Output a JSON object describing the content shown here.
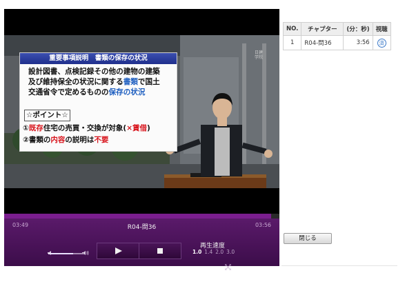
{
  "video": {
    "logo_text": "日建学院",
    "slide": {
      "heading": "重要事項説明　書類の保存の状況",
      "line1": "設計図書、点検記録その他の建物の建築",
      "line2_pre": "及び維持保全の状況に関する",
      "line2_hl": "書類",
      "line2_post": "で国土",
      "line3_pre": "交通省令で定めるものの",
      "line3_hl": "保存の状況",
      "point": "☆ポイント☆",
      "rule1_pre": "①",
      "rule1_red1": "既存",
      "rule1_mid": "住宅の売買・交換が対象(",
      "rule1_red2": "×賃借",
      "rule1_end": ")",
      "rule2_pre": "②書類の",
      "rule2_red1": "内容",
      "rule2_mid": "の説明は",
      "rule2_red2": "不要"
    }
  },
  "player": {
    "current_time": "03:49",
    "total_time": "03:56",
    "title": "R04-問36",
    "progress": 0.97,
    "volume": 0.7,
    "speed_label": "再生速度",
    "speeds": [
      "1.0",
      "1.4",
      "2.0",
      "3.0"
    ],
    "active_speed": "1.0"
  },
  "chapters": {
    "headers": [
      "NO.",
      "チャプター",
      "(分：秒)",
      "視聴"
    ],
    "rows": [
      {
        "no": "1",
        "chapter": "R04-問36",
        "time": "3:56",
        "watched": "済"
      }
    ]
  },
  "close_label": "閉じる",
  "colors": {
    "control_bar": "#4a1458",
    "progress": "#7a1e8e",
    "watched_icon": "#3a78c8",
    "slide_header": "#1f2f8c"
  }
}
